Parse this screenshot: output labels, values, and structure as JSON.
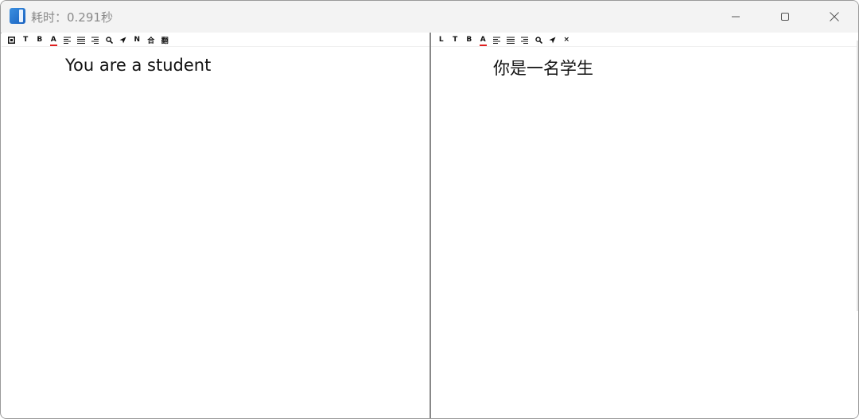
{
  "window": {
    "title": "耗时：0.291秒"
  },
  "left_pane": {
    "toolbar": [
      "▣",
      "T",
      "B",
      "A",
      "align-left",
      "align-justify",
      "align-right",
      "search",
      "send",
      "N",
      "合",
      "翻"
    ],
    "text": "You are a student"
  },
  "right_pane": {
    "toolbar": [
      "L",
      "T",
      "B",
      "A",
      "align-left",
      "align-justify",
      "align-right",
      "search",
      "send",
      "×"
    ],
    "text": "你是一名学生"
  },
  "colors": {
    "titlebar": "#f3f3f3",
    "divider": "#888888",
    "font_color_underline": "#e02020"
  }
}
